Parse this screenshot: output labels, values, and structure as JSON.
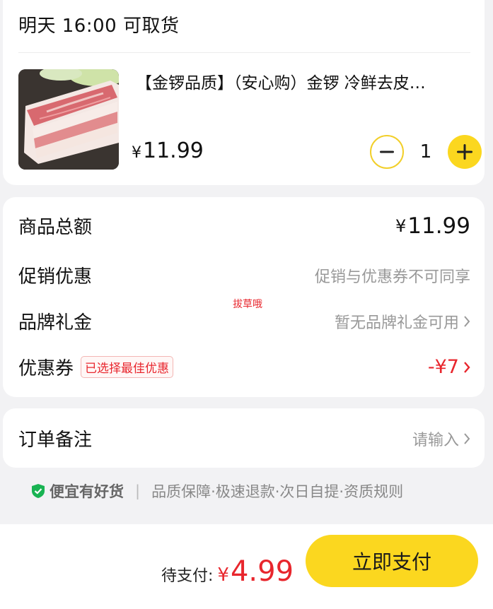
{
  "pickup": {
    "text": "明天 16:00 可取货"
  },
  "product": {
    "title": "【金锣品质】（安心购）金锣 冷鲜去皮…",
    "currency": "¥",
    "price": "11.99",
    "quantity": "1",
    "image_icon": "pork-belly-image"
  },
  "summary": {
    "total_label": "商品总额",
    "total_currency": "¥",
    "total_value": "11.99",
    "promo_label": "促销优惠",
    "promo_value": "促销与优惠券不可同享",
    "brand_gift_label": "品牌礼金",
    "brand_gift_value": "暂无品牌礼金可用",
    "coupon_label": "优惠券",
    "coupon_tag": "已选择最佳优惠",
    "coupon_value": "-¥7",
    "watermark": "拔草哦"
  },
  "remark": {
    "label": "订单备注",
    "placeholder": "请输入"
  },
  "guarantee": {
    "brand": "便宜有好货",
    "items": "品质保障·极速退款·次日自提·资质规则"
  },
  "footer": {
    "pay_label": "待支付:",
    "pay_currency": "¥",
    "pay_amount": "4.99",
    "pay_button": "立即支付"
  },
  "colors": {
    "accent_yellow": "#fbd71f",
    "price_red": "#e8262d",
    "shield_green": "#19b352"
  }
}
